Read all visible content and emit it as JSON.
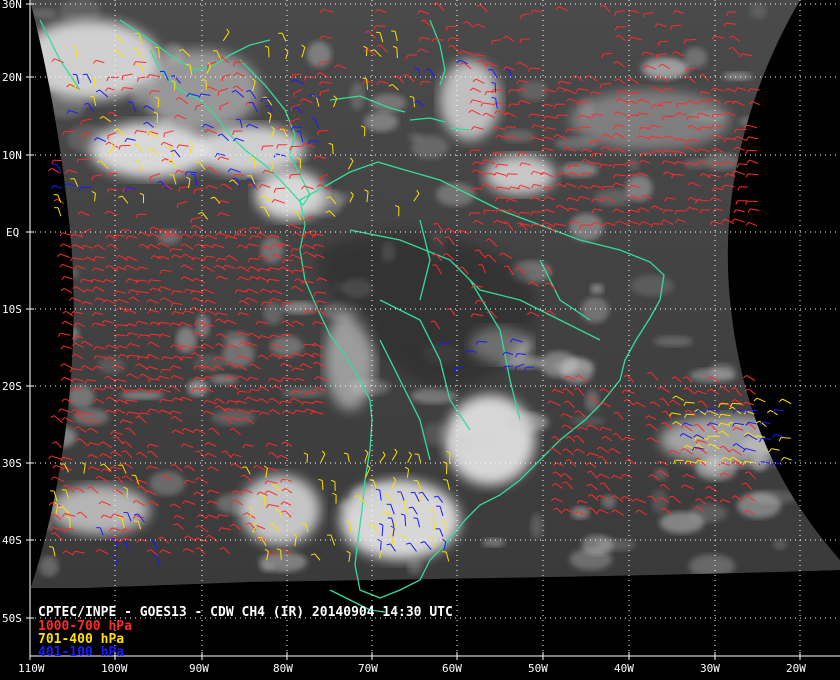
{
  "title": "CPTEC/INPE - GOES13 - CDW CH4 (IR) 20140904 14:30 UTC",
  "legend": [
    {
      "label": "1000-700 hPa",
      "color": "#ff2a2a"
    },
    {
      "label": "701-400 hPa",
      "color": "#ffe000"
    },
    {
      "label": "401-100 hPa",
      "color": "#1b1bff"
    }
  ],
  "lat_labels": [
    "30N",
    "20N",
    "10N",
    "EQ",
    "10S",
    "20S",
    "30S",
    "40S",
    "50S"
  ],
  "lon_labels": [
    "110W",
    "100W",
    "90W",
    "80W",
    "70W",
    "60W",
    "50W",
    "40W",
    "30W",
    "20W"
  ],
  "colors": {
    "coast": "#33dd99",
    "grid": "#ffffff",
    "space": "#000000"
  }
}
